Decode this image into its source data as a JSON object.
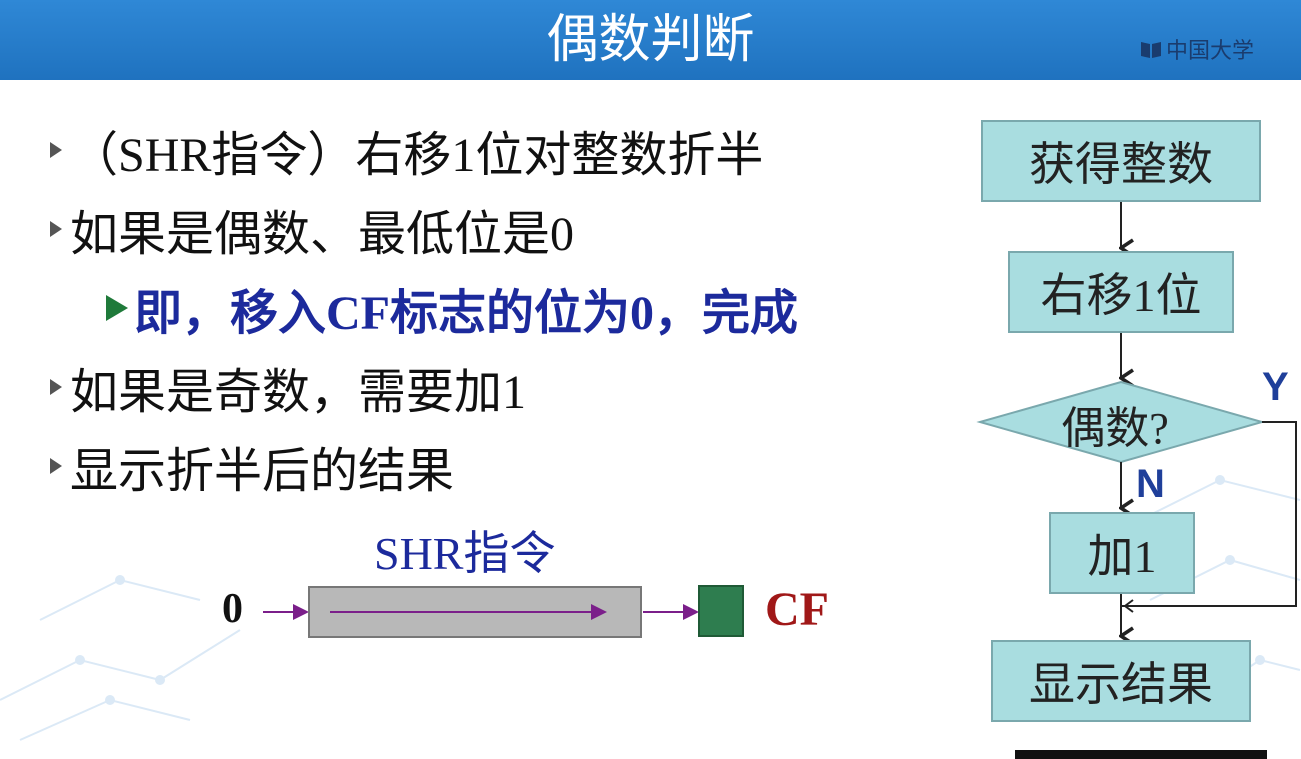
{
  "header": {
    "title": "偶数判断",
    "logo_text": "中国大学"
  },
  "bullets": [
    {
      "text": "（SHR指令）右移1位对整数折半"
    },
    {
      "text": "如果是偶数、最低位是0"
    },
    {
      "text": "即，移入CF标志的位为0，完成"
    },
    {
      "text": "如果是奇数，需要加1"
    },
    {
      "text": "显示折半后的结果"
    }
  ],
  "shr_diagram": {
    "title": "SHR指令",
    "input_label": "0",
    "flag_label": "CF"
  },
  "flowchart": {
    "steps": [
      "获得整数",
      "右移1位",
      "偶数?",
      "加1",
      "显示结果"
    ],
    "yes_label": "Y",
    "no_label": "N"
  },
  "colors": {
    "header_blue": "#1f72bf",
    "box_fill": "#a9dde0",
    "flag_green": "#2e7d4f",
    "cf_red": "#a01818",
    "subtext_blue": "#1c2a9c",
    "arrow_purple": "#7b1f8a"
  }
}
